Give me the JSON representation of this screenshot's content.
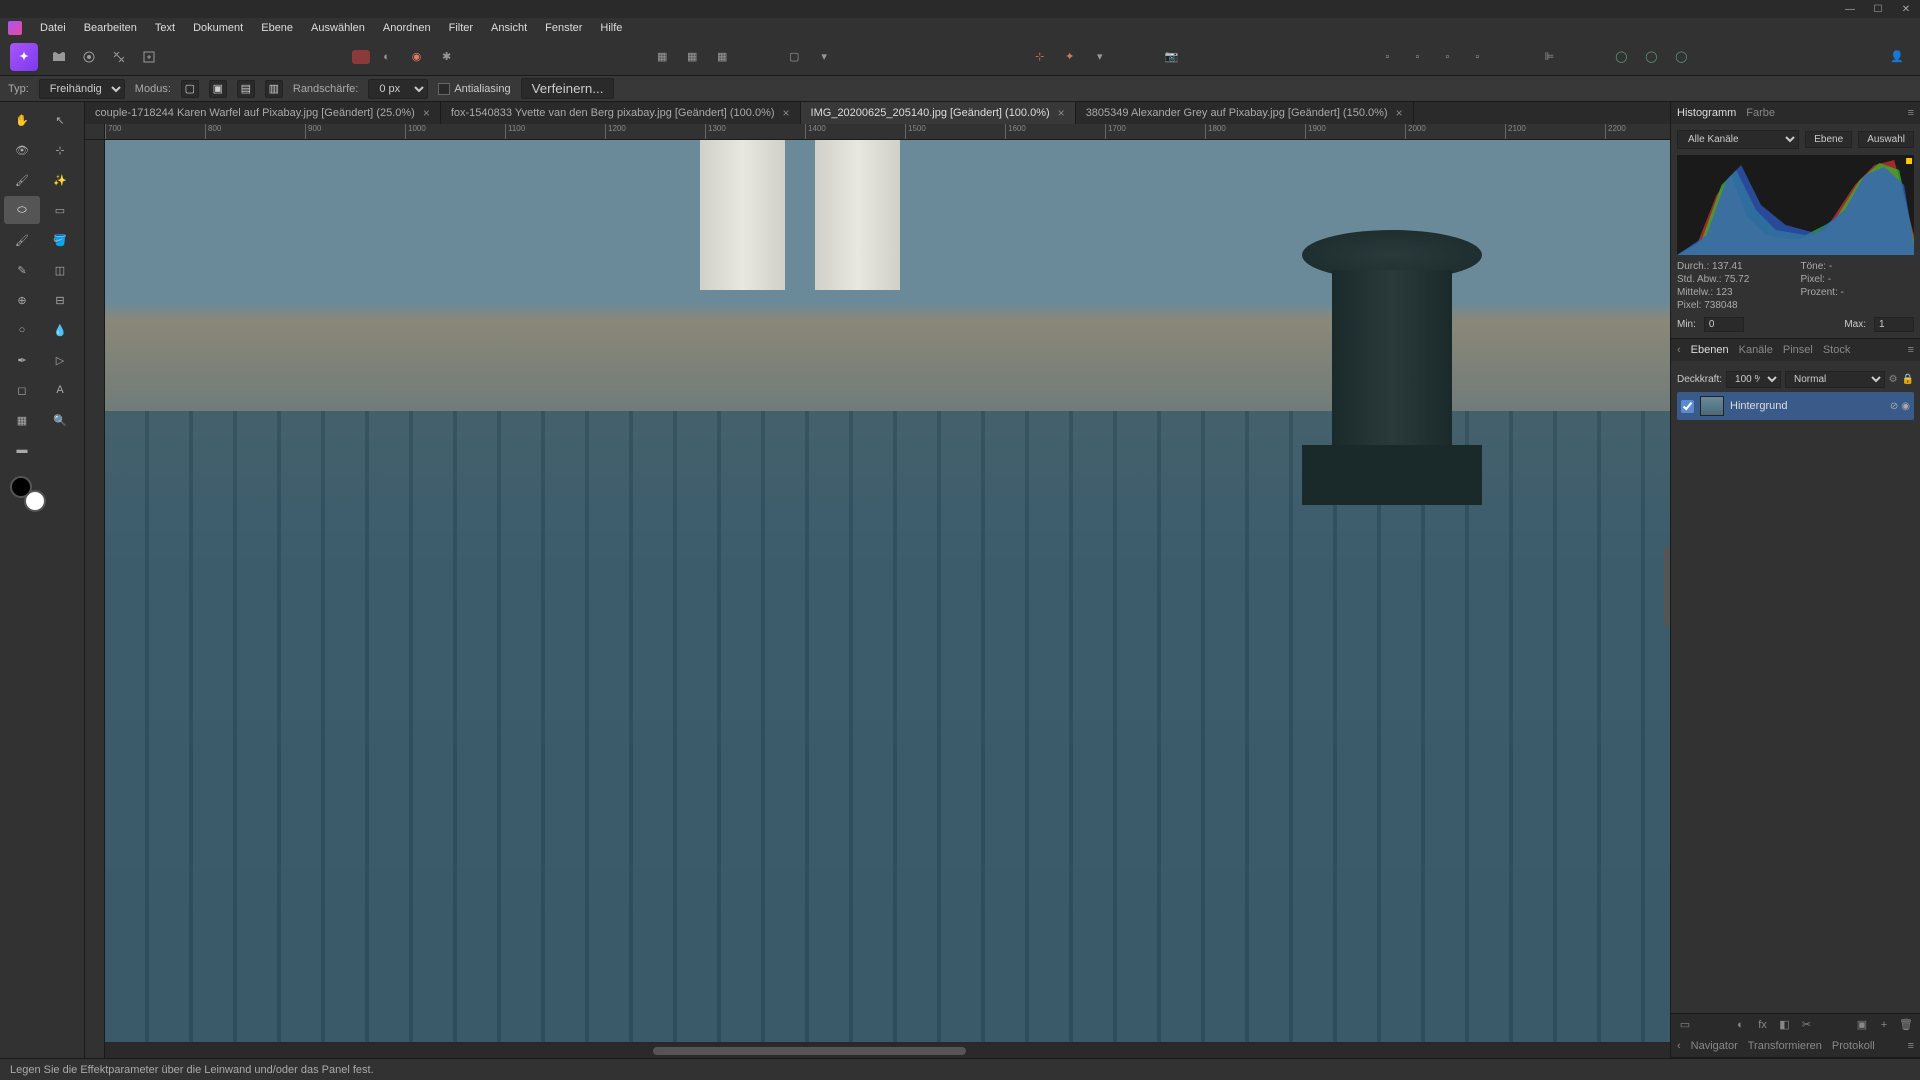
{
  "menu": [
    "Datei",
    "Bearbeiten",
    "Text",
    "Dokument",
    "Ebene",
    "Auswählen",
    "Anordnen",
    "Filter",
    "Ansicht",
    "Fenster",
    "Hilfe"
  ],
  "optionbar": {
    "typ_label": "Typ:",
    "typ_value": "Freihändig",
    "modus_label": "Modus:",
    "randschaerfe_label": "Randschärfe:",
    "randschaerfe_value": "0 px",
    "antialiasing_label": "Antialiasing",
    "verfeinern_label": "Verfeinern..."
  },
  "tabs": [
    {
      "label": "couple-1718244 Karen Warfel auf Pixabay.jpg [Geändert] (25.0%)",
      "active": false
    },
    {
      "label": "fox-1540833 Yvette van den Berg pixabay.jpg [Geändert] (100.0%)",
      "active": false
    },
    {
      "label": "IMG_20200625_205140.jpg [Geändert] (100.0%)",
      "active": true
    },
    {
      "label": "3805349 Alexander Grey auf Pixabay.jpg [Geändert] (150.0%)",
      "active": false
    }
  ],
  "ruler_ticks": [
    "700",
    "800",
    "900",
    "1000",
    "1100",
    "1200",
    "1300",
    "1400",
    "1500",
    "1600",
    "1700",
    "1800",
    "1900",
    "2000",
    "2100",
    "2200"
  ],
  "histogram": {
    "tabs": [
      "Histogramm",
      "Farbe"
    ],
    "channel_label": "Alle Kanäle",
    "ebene_btn": "Ebene",
    "auswahl_btn": "Auswahl",
    "stats": {
      "durch_label": "Durch.:",
      "durch_val": "137.41",
      "stdabw_label": "Std. Abw.:",
      "stdabw_val": "75.72",
      "mittelw_label": "Mittelw.:",
      "mittelw_val": "123",
      "pixel_label": "Pixel:",
      "pixel_val": "738048",
      "toene_label": "Töne:",
      "toene_val": "-",
      "pixel2_label": "Pixel:",
      "pixel2_val": "-",
      "prozent_label": "Prozent:",
      "prozent_val": "-"
    },
    "min_label": "Min:",
    "min_val": "0",
    "max_label": "Max:",
    "max_val": "1"
  },
  "layers": {
    "tabs": [
      "Ebenen",
      "Kanäle",
      "Pinsel",
      "Stock"
    ],
    "deckkraft_label": "Deckkraft:",
    "deckkraft_val": "100 %",
    "blend_val": "Normal",
    "layer_name": "Hintergrund"
  },
  "bottom_panel_tabs": [
    "Navigator",
    "Transformieren",
    "Protokoll"
  ],
  "status": "Legen Sie die Effektparameter über die Leinwand und/oder das Panel fest."
}
